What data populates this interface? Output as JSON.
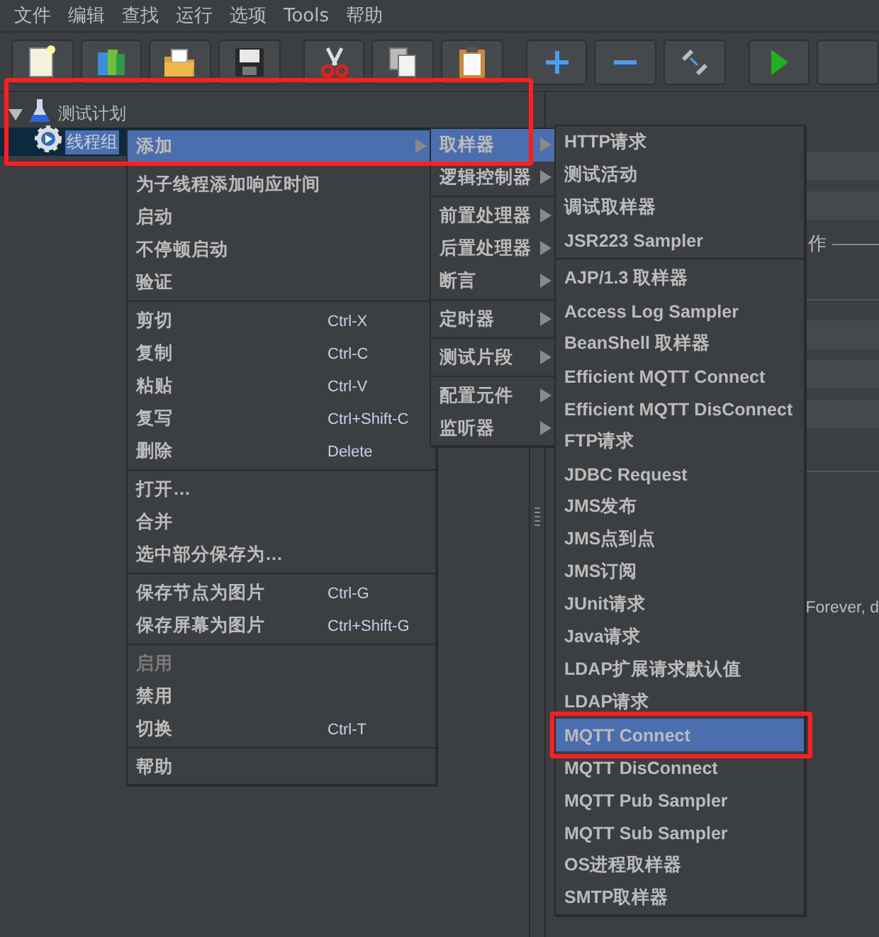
{
  "menu_bar": [
    {
      "label": "文件"
    },
    {
      "label": "编辑"
    },
    {
      "label": "查找"
    },
    {
      "label": "运行"
    },
    {
      "label": "选项"
    },
    {
      "label": "Tools"
    },
    {
      "label": "帮助"
    }
  ],
  "toolbar": [
    {
      "kind": "new"
    },
    {
      "kind": "templates"
    },
    {
      "kind": "open"
    },
    {
      "kind": "save"
    },
    {
      "kind": "cut",
      "group_start": true
    },
    {
      "kind": "copy"
    },
    {
      "kind": "paste"
    },
    {
      "kind": "expand",
      "group_start": true
    },
    {
      "kind": "collapse"
    },
    {
      "kind": "toggle"
    },
    {
      "kind": "start",
      "group_start": true
    },
    {
      "kind": "blank"
    }
  ],
  "tree": [
    {
      "label": "测试计划",
      "expanded": true,
      "selected": false,
      "children": [
        {
          "label": "线程组",
          "selected": true
        }
      ]
    }
  ],
  "right_panel": {
    "section_label": "作",
    "loop_text": "Forever, d"
  },
  "menus": [
    {
      "groups": [
        [
          {
            "label": "添加",
            "submenu": true,
            "selected": true,
            "disabled": false
          }
        ],
        [
          {
            "label": "为子线程添加响应时间",
            "selected": false,
            "disabled": false
          },
          {
            "label": "启动",
            "selected": false,
            "disabled": false
          },
          {
            "label": "不停顿启动",
            "selected": false,
            "disabled": false
          },
          {
            "label": "验证",
            "selected": false,
            "disabled": false
          }
        ],
        [
          {
            "label": "剪切",
            "shortcut": "Ctrl-X",
            "selected": false,
            "disabled": false
          },
          {
            "label": "复制",
            "shortcut": "Ctrl-C",
            "selected": false,
            "disabled": false
          },
          {
            "label": "粘贴",
            "shortcut": "Ctrl-V",
            "selected": false,
            "disabled": false
          },
          {
            "label": "复写",
            "shortcut": "Ctrl+Shift-C",
            "selected": false,
            "disabled": false
          },
          {
            "label": "删除",
            "shortcut": "Delete",
            "selected": false,
            "disabled": false
          }
        ],
        [
          {
            "label": "打开…",
            "selected": false,
            "disabled": false
          },
          {
            "label": "合并",
            "selected": false,
            "disabled": false
          },
          {
            "label": "选中部分保存为…",
            "selected": false,
            "disabled": false
          }
        ],
        [
          {
            "label": "保存节点为图片",
            "shortcut": "Ctrl-G",
            "selected": false,
            "disabled": false
          },
          {
            "label": "保存屏幕为图片",
            "shortcut": "Ctrl+Shift-G",
            "selected": false,
            "disabled": false
          }
        ],
        [
          {
            "label": "启用",
            "selected": false,
            "disabled": true
          },
          {
            "label": "禁用",
            "selected": false,
            "disabled": false
          },
          {
            "label": "切换",
            "shortcut": "Ctrl-T",
            "selected": false,
            "disabled": false
          }
        ],
        [
          {
            "label": "帮助",
            "selected": false,
            "disabled": false
          }
        ]
      ]
    },
    {
      "groups": [
        [
          {
            "label": "取样器",
            "submenu": true,
            "selected": true,
            "disabled": false
          },
          {
            "label": "逻辑控制器",
            "submenu": true,
            "selected": false,
            "disabled": false
          }
        ],
        [
          {
            "label": "前置处理器",
            "submenu": true,
            "selected": false,
            "disabled": false
          },
          {
            "label": "后置处理器",
            "submenu": true,
            "selected": false,
            "disabled": false
          },
          {
            "label": "断言",
            "submenu": true,
            "selected": false,
            "disabled": false
          }
        ],
        [
          {
            "label": "定时器",
            "submenu": true,
            "selected": false,
            "disabled": false
          }
        ],
        [
          {
            "label": "测试片段",
            "submenu": true,
            "selected": false,
            "disabled": false
          }
        ],
        [
          {
            "label": "配置元件",
            "submenu": true,
            "selected": false,
            "disabled": false
          },
          {
            "label": "监听器",
            "submenu": true,
            "selected": false,
            "disabled": false
          }
        ]
      ]
    },
    {
      "groups": [
        [
          {
            "label": "HTTP请求",
            "selected": false,
            "disabled": false
          },
          {
            "label": "测试活动",
            "selected": false,
            "disabled": false
          },
          {
            "label": "调试取样器",
            "selected": false,
            "disabled": false
          },
          {
            "label": "JSR223 Sampler",
            "selected": false,
            "disabled": false
          }
        ],
        [
          {
            "label": "AJP/1.3 取样器",
            "selected": false,
            "disabled": false
          },
          {
            "label": "Access Log Sampler",
            "selected": false,
            "disabled": false
          },
          {
            "label": "BeanShell 取样器",
            "selected": false,
            "disabled": false
          },
          {
            "label": "Efficient MQTT Connect",
            "selected": false,
            "disabled": false
          },
          {
            "label": "Efficient MQTT DisConnect",
            "selected": false,
            "disabled": false
          },
          {
            "label": "FTP请求",
            "selected": false,
            "disabled": false
          },
          {
            "label": "JDBC Request",
            "selected": false,
            "disabled": false
          },
          {
            "label": "JMS发布",
            "selected": false,
            "disabled": false
          },
          {
            "label": "JMS点到点",
            "selected": false,
            "disabled": false
          },
          {
            "label": "JMS订阅",
            "selected": false,
            "disabled": false
          },
          {
            "label": "JUnit请求",
            "selected": false,
            "disabled": false
          },
          {
            "label": "Java请求",
            "selected": false,
            "disabled": false
          },
          {
            "label": "LDAP扩展请求默认值",
            "selected": false,
            "disabled": false
          },
          {
            "label": "LDAP请求",
            "selected": false,
            "disabled": false
          },
          {
            "label": "MQTT Connect",
            "selected": true,
            "disabled": false
          },
          {
            "label": "MQTT DisConnect",
            "selected": false,
            "disabled": false
          },
          {
            "label": "MQTT Pub Sampler",
            "selected": false,
            "disabled": false
          },
          {
            "label": "MQTT Sub Sampler",
            "selected": false,
            "disabled": false
          },
          {
            "label": "OS进程取样器",
            "selected": false,
            "disabled": false
          },
          {
            "label": "SMTP取样器",
            "selected": false,
            "disabled": false
          }
        ]
      ]
    }
  ]
}
